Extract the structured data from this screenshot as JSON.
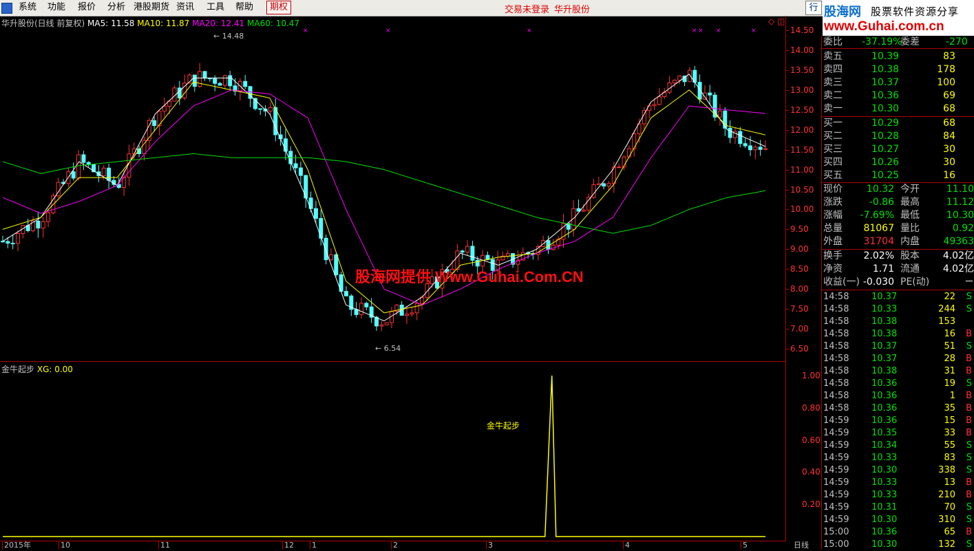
{
  "menu": {
    "items": [
      "系统",
      "功能",
      "报价",
      "分析",
      "港股期货",
      "资讯",
      "工具",
      "帮助"
    ],
    "active": "期权",
    "status_login": "交易未登录",
    "status_stock": "华升股份",
    "right_btn": "行"
  },
  "brand": {
    "name": "股海网",
    "slogan": "股票软件资源分享",
    "url": "www.Guhai.com.cn"
  },
  "watermark": "股海网提供 Www.Guhai.Com.CN",
  "main_chart": {
    "title": "华升股份(日线 前复权)",
    "ma5_label": "MA5: 11.58",
    "ma10_label": "MA10: 11.87",
    "ma20_label": "MA20: 12.41",
    "ma60_label": "MA60: 10.47",
    "high_label": "14.48",
    "low_label": "6.54",
    "y_ticks": [
      "14.50",
      "14.00",
      "13.50",
      "13.00",
      "12.50",
      "12.00",
      "11.50",
      "11.00",
      "10.50",
      "10.00",
      "9.50",
      "9.00",
      "8.50",
      "8.00",
      "7.50",
      "7.00",
      "6.50"
    ],
    "colors": {
      "up": "#ff3232",
      "down": "#54ffff",
      "ma5": "#ffffff",
      "ma10": "#ffff00",
      "ma20": "#ff00ff",
      "ma60": "#00e000"
    }
  },
  "sub_chart": {
    "title": "金牛起步",
    "xg_label": "XG: 0.00",
    "marker_label": "金牛起步",
    "y_ticks": [
      "1.00",
      "0.80",
      "0.60",
      "0.40",
      "0.20"
    ]
  },
  "x_axis": {
    "labels": [
      "2015年",
      "10",
      "11",
      "12",
      "1",
      "2",
      "3",
      "4",
      "5"
    ],
    "period": "日线"
  },
  "chart_data": {
    "type": "line",
    "title": "华升股份(日线 前复权)",
    "xlabel": "",
    "ylabel": "",
    "ylim": [
      6.5,
      14.5
    ],
    "high": 14.48,
    "low": 6.54,
    "x": [
      0,
      5,
      10,
      15,
      20,
      25,
      30,
      35,
      40,
      45,
      50,
      55,
      60,
      65,
      70,
      75,
      80,
      85,
      90,
      95,
      100
    ],
    "series": [
      {
        "name": "MA5",
        "values": [
          9.2,
          9.8,
          11.2,
          10.6,
          12.4,
          13.3,
          13.3,
          12.4,
          10.2,
          7.6,
          7.2,
          7.8,
          8.9,
          8.6,
          9.0,
          9.8,
          11.0,
          12.7,
          13.4,
          12.0,
          11.58
        ]
      },
      {
        "name": "MA10",
        "values": [
          9.5,
          9.8,
          10.8,
          10.8,
          12.0,
          13.2,
          13.0,
          12.8,
          11.0,
          8.2,
          7.4,
          7.6,
          8.6,
          8.8,
          8.9,
          9.5,
          10.6,
          12.3,
          13.0,
          12.1,
          11.87
        ]
      },
      {
        "name": "MA20",
        "values": [
          10.3,
          9.9,
          10.2,
          10.6,
          11.7,
          12.6,
          13.0,
          12.9,
          12.3,
          10.0,
          8.0,
          7.6,
          8.0,
          8.5,
          8.9,
          9.2,
          9.8,
          11.3,
          12.6,
          12.5,
          12.41
        ]
      },
      {
        "name": "MA60",
        "values": [
          11.2,
          10.9,
          11.1,
          11.2,
          11.3,
          11.4,
          11.3,
          11.3,
          11.3,
          11.2,
          11.0,
          10.7,
          10.4,
          10.1,
          9.8,
          9.6,
          9.4,
          9.6,
          10.0,
          10.3,
          10.47
        ]
      }
    ],
    "sub_indicator": {
      "name": "XG",
      "signal_index": 72,
      "signal_value": 1.0,
      "ylim": [
        0,
        1
      ]
    }
  },
  "quote": {
    "weibi": {
      "label1": "委比",
      "value1": "-37.19%",
      "label2": "委差",
      "value2": "-270"
    },
    "asks": [
      {
        "label": "卖五",
        "price": "10.39",
        "vol": "83"
      },
      {
        "label": "卖四",
        "price": "10.38",
        "vol": "178"
      },
      {
        "label": "卖三",
        "price": "10.37",
        "vol": "100"
      },
      {
        "label": "卖二",
        "price": "10.36",
        "vol": "69"
      },
      {
        "label": "卖一",
        "price": "10.30",
        "vol": "68"
      }
    ],
    "bids": [
      {
        "label": "买一",
        "price": "10.29",
        "vol": "68"
      },
      {
        "label": "买二",
        "price": "10.28",
        "vol": "84"
      },
      {
        "label": "买三",
        "price": "10.27",
        "vol": "30"
      },
      {
        "label": "买四",
        "price": "10.26",
        "vol": "30"
      },
      {
        "label": "买五",
        "price": "10.25",
        "vol": "16"
      }
    ],
    "stats": [
      {
        "l1": "现价",
        "v1": "10.32",
        "c1": "#00e000",
        "l2": "今开",
        "v2": "11.10",
        "c2": "#00e000"
      },
      {
        "l1": "涨跌",
        "v1": "-0.86",
        "c1": "#00e000",
        "l2": "最高",
        "v2": "11.12",
        "c2": "#00e000"
      },
      {
        "l1": "涨幅",
        "v1": "-7.69%",
        "c1": "#00e000",
        "l2": "最低",
        "v2": "10.30",
        "c2": "#00e000"
      },
      {
        "l1": "总量",
        "v1": "81067",
        "c1": "#ffff00",
        "l2": "量比",
        "v2": "0.92",
        "c2": "#00e000"
      },
      {
        "l1": "外盘",
        "v1": "31704",
        "c1": "#ff3232",
        "l2": "内盘",
        "v2": "49363",
        "c2": "#00e000"
      }
    ],
    "stats2": [
      {
        "l1": "换手",
        "v1": "2.02%",
        "l2": "股本",
        "v2": "4.02亿"
      },
      {
        "l1": "净资",
        "v1": "1.71",
        "l2": "流通",
        "v2": "4.02亿"
      },
      {
        "l1": "收益(一)",
        "v1": "-0.030",
        "l2": "PE(动)",
        "v2": "－"
      }
    ]
  },
  "ticks": [
    {
      "time": "14:58",
      "price": "10.37",
      "vol": "22",
      "side": "S"
    },
    {
      "time": "14:58",
      "price": "10.33",
      "vol": "244",
      "side": "S"
    },
    {
      "time": "14:58",
      "price": "10.38",
      "vol": "153",
      "side": ""
    },
    {
      "time": "14:58",
      "price": "10.38",
      "vol": "16",
      "side": "B"
    },
    {
      "time": "14:58",
      "price": "10.37",
      "vol": "51",
      "side": "S"
    },
    {
      "time": "14:58",
      "price": "10.37",
      "vol": "28",
      "side": "B"
    },
    {
      "time": "14:58",
      "price": "10.38",
      "vol": "31",
      "side": "B"
    },
    {
      "time": "14:58",
      "price": "10.36",
      "vol": "19",
      "side": "S"
    },
    {
      "time": "14:58",
      "price": "10.36",
      "vol": "1",
      "side": "B"
    },
    {
      "time": "14:58",
      "price": "10.36",
      "vol": "35",
      "side": "B"
    },
    {
      "time": "14:59",
      "price": "10.36",
      "vol": "15",
      "side": "B"
    },
    {
      "time": "14:59",
      "price": "10.35",
      "vol": "33",
      "side": "B"
    },
    {
      "time": "14:59",
      "price": "10.34",
      "vol": "55",
      "side": "S"
    },
    {
      "time": "14:59",
      "price": "10.33",
      "vol": "83",
      "side": "S"
    },
    {
      "time": "14:59",
      "price": "10.30",
      "vol": "338",
      "side": "S"
    },
    {
      "time": "14:59",
      "price": "10.33",
      "vol": "13",
      "side": "B"
    },
    {
      "time": "14:59",
      "price": "10.33",
      "vol": "210",
      "side": "B"
    },
    {
      "time": "14:59",
      "price": "10.31",
      "vol": "70",
      "side": "S"
    },
    {
      "time": "14:59",
      "price": "10.30",
      "vol": "310",
      "side": "S"
    },
    {
      "time": "15:00",
      "price": "10.36",
      "vol": "65",
      "side": "B"
    },
    {
      "time": "15:00",
      "price": "10.30",
      "vol": "132",
      "side": "S"
    }
  ]
}
